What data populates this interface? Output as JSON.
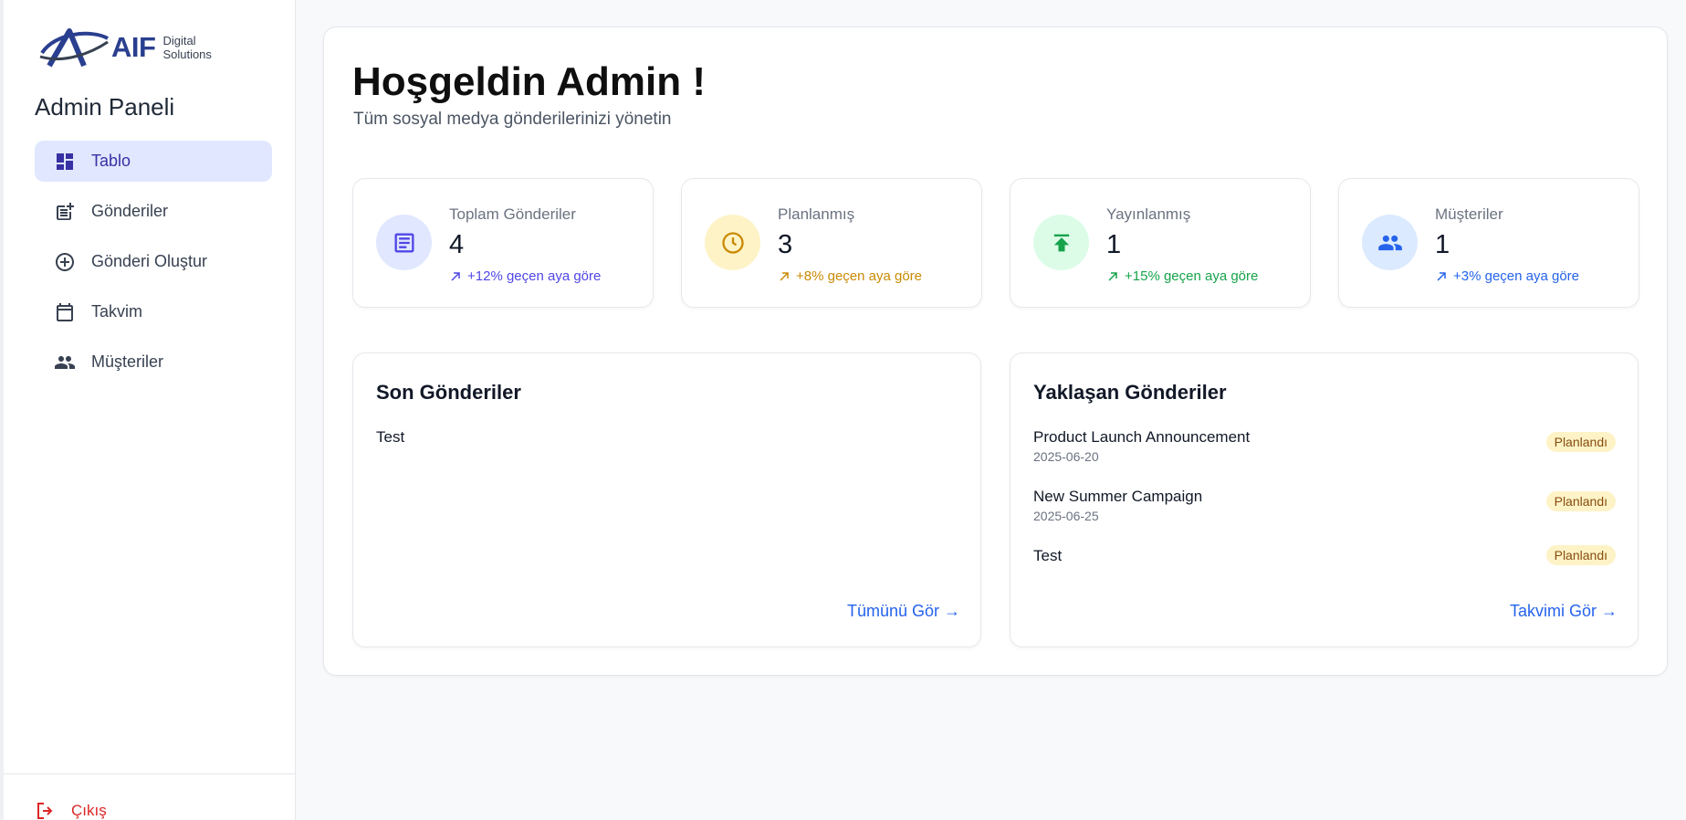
{
  "brand": {
    "name": "AIF",
    "sub1": "Digital",
    "sub2": "Solutions"
  },
  "sidebar": {
    "title": "Admin Paneli",
    "items": [
      {
        "label": "Tablo",
        "icon": "dashboard-icon",
        "active": true
      },
      {
        "label": "Gönderiler",
        "icon": "post-add-icon"
      },
      {
        "label": "Gönderi Oluştur",
        "icon": "add-circle-icon"
      },
      {
        "label": "Takvim",
        "icon": "calendar-icon"
      },
      {
        "label": "Müşteriler",
        "icon": "people-icon"
      }
    ],
    "logout": "Çıkış"
  },
  "header": {
    "title": "Hoşgeldin Admin !",
    "subtitle": "Tüm sosyal medya gönderilerinizi yönetin"
  },
  "stats": [
    {
      "label": "Toplam Gönderiler",
      "value": "4",
      "trend": "+12% geçen aya göre",
      "icon": "article-icon",
      "color": "#4f46e5",
      "bg": "#e0e7ff"
    },
    {
      "label": "Planlanmış",
      "value": "3",
      "trend": "+8% geçen aya göre",
      "icon": "clock-icon",
      "color": "#ca8a04",
      "bg": "#fef3c7"
    },
    {
      "label": "Yayınlanmış",
      "value": "1",
      "trend": "+15% geçen aya göre",
      "icon": "publish-icon",
      "color": "#16a34a",
      "bg": "#dcfce7"
    },
    {
      "label": "Müşteriler",
      "value": "1",
      "trend": "+3% geçen aya göre",
      "icon": "people-icon",
      "color": "#2563eb",
      "bg": "#dbeafe"
    }
  ],
  "recent": {
    "title": "Son Gönderiler",
    "items": [
      {
        "title": "Test"
      }
    ],
    "link": "Tümünü Gör →"
  },
  "upcoming": {
    "title": "Yaklaşan Gönderiler",
    "items": [
      {
        "title": "Product Launch Announcement",
        "date": "2025-06-20",
        "status": "Planlandı"
      },
      {
        "title": "New Summer Campaign",
        "date": "2025-06-25",
        "status": "Planlandı"
      },
      {
        "title": "Test",
        "date": "",
        "status": "Planlandı"
      }
    ],
    "link": "Takvimi Gör →"
  }
}
